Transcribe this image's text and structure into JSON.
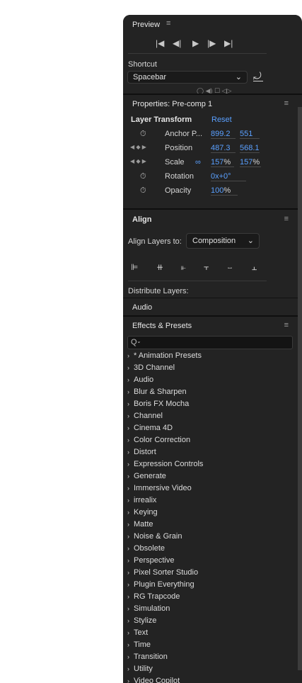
{
  "preview": {
    "title": "Preview",
    "controls": [
      "|◀",
      "◀|",
      "▶",
      "|▶",
      "▶|"
    ],
    "shortcut_label": "Shortcut",
    "shortcut_value": "Spacebar"
  },
  "properties": {
    "title": "Properties: Pre-comp 1",
    "section": "Layer Transform",
    "reset": "Reset",
    "rows": [
      {
        "label": "Anchor P...",
        "v1": "899.2",
        "v2": "551"
      },
      {
        "label": "Position",
        "v1": "487.3",
        "v2": "568.1"
      },
      {
        "label": "Scale",
        "v1": "157",
        "u1": "%",
        "v2": "157",
        "u2": "%"
      },
      {
        "label": "Rotation",
        "v1": "0x+0°"
      },
      {
        "label": "Opacity",
        "v1": "100",
        "u1": "%"
      }
    ]
  },
  "align": {
    "title": "Align",
    "align_to_label": "Align Layers to:",
    "align_to_value": "Composition",
    "distribute_label": "Distribute Layers:"
  },
  "audio": {
    "title": "Audio"
  },
  "effects": {
    "title": "Effects & Presets",
    "search_icon": "Q",
    "items": [
      "* Animation Presets",
      "3D Channel",
      "Audio",
      "Blur & Sharpen",
      "Boris FX Mocha",
      "Channel",
      "Cinema 4D",
      "Color Correction",
      "Distort",
      "Expression Controls",
      "Generate",
      "Immersive Video",
      "irrealix",
      "Keying",
      "Matte",
      "Noise & Grain",
      "Obsolete",
      "Perspective",
      "Pixel Sorter Studio",
      "Plugin Everything",
      "RG Trapcode",
      "Simulation",
      "Stylize",
      "Text",
      "Time",
      "Transition",
      "Utility",
      "Video Copilot"
    ]
  }
}
